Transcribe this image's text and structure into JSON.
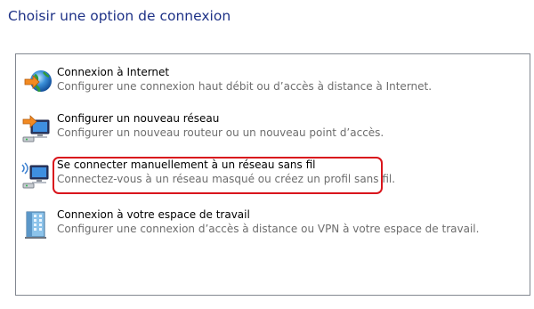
{
  "page": {
    "title": "Choisir une option de connexion"
  },
  "options": [
    {
      "title": "Connexion à Internet",
      "description": "Configurer une connexion haut débit ou d’accès à distance à Internet.",
      "icon": "globe-network-icon"
    },
    {
      "title": "Configurer un nouveau réseau",
      "description": "Configurer un nouveau routeur ou un nouveau point d’accès.",
      "icon": "new-network-icon"
    },
    {
      "title": "Se connecter manuellement à un réseau sans fil",
      "description": "Connectez-vous à un réseau masqué ou créez un profil sans fil.",
      "icon": "wireless-network-icon"
    },
    {
      "title": "Connexion à votre espace de travail",
      "description": "Configurer une connexion d’accès à distance ou VPN à votre espace de travail.",
      "icon": "workplace-building-icon"
    }
  ],
  "colors": {
    "title": "#1e3287",
    "description": "#6d6d6d",
    "highlight": "#d9151c",
    "panel_border": "#828790"
  }
}
